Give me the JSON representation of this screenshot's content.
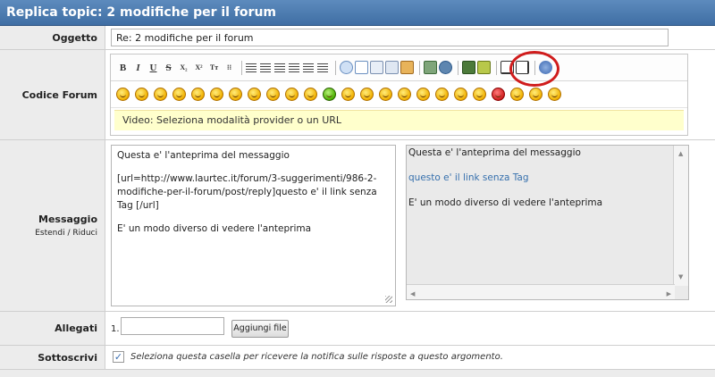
{
  "header": {
    "title": "Replica topic: 2 modifiche per il forum"
  },
  "subject": {
    "label": "Oggetto",
    "value": "Re: 2 modifiche per il forum"
  },
  "bbcode": {
    "label": "Codice Forum",
    "toolbar": {
      "text_buttons": [
        {
          "glyph": "B",
          "icon": "bold-icon"
        },
        {
          "glyph": "I",
          "icon": "italic-icon"
        },
        {
          "glyph": "U",
          "icon": "underline-icon"
        },
        {
          "glyph": "S",
          "icon": "strikethrough-icon"
        },
        {
          "glyph": "X₂",
          "icon": "subscript-icon"
        },
        {
          "glyph": "X²",
          "icon": "superscript-icon"
        },
        {
          "glyph": "Tт",
          "icon": "typewriter-icon"
        },
        {
          "glyph": "⁝⁝",
          "icon": "size-icon"
        }
      ]
    },
    "smiley_count": 24,
    "video_hint": "Video: Seleziona modalità provider o un URL"
  },
  "message": {
    "label": "Messaggio",
    "expand": "Estendi",
    "separator": "/",
    "shrink": "Riduci",
    "text_lines": [
      "Questa e' l'anteprima del messaggio",
      "[url=http://www.laurtec.it/forum/3-suggerimenti/986-2-modifiche-per-il-forum/post/reply]questo e' il link senza Tag [/url]",
      "E' un modo diverso di vedere l'anteprima"
    ],
    "preview": {
      "line1": "Questa e' l'anteprima del messaggio",
      "link": "questo e' il link senza Tag",
      "line3": "E' un modo diverso di vedere l'anteprima"
    }
  },
  "attachments": {
    "label": "Allegati",
    "index": "1.",
    "button": "Aggiungi file"
  },
  "subscribe": {
    "label": "Sottoscrivi",
    "checked": "✓",
    "text": "Seleziona questa casella per ricevere la notifica sulle risposte a questo argomento."
  },
  "colors": {
    "header": "#4a79ae",
    "label_bg": "#ececec",
    "video_bg": "#ffffcc",
    "highlight_ring": "#d01c1c",
    "link": "#3670ad"
  }
}
